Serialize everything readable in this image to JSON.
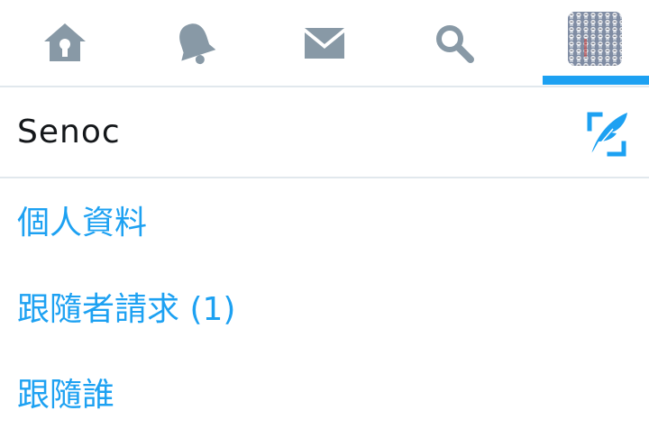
{
  "nav": {
    "icons": [
      "home-icon",
      "notifications-bell-icon",
      "messages-envelope-icon",
      "search-icon",
      "account-avatar"
    ],
    "active_tab": "account",
    "accent_color": "#1DA1F2",
    "icon_color": "#8899A6"
  },
  "account": {
    "name": "Senoc"
  },
  "menu": {
    "profile": "個人資料",
    "follower_requests": "跟隨者請求 (1)",
    "following": "跟隨誰"
  }
}
